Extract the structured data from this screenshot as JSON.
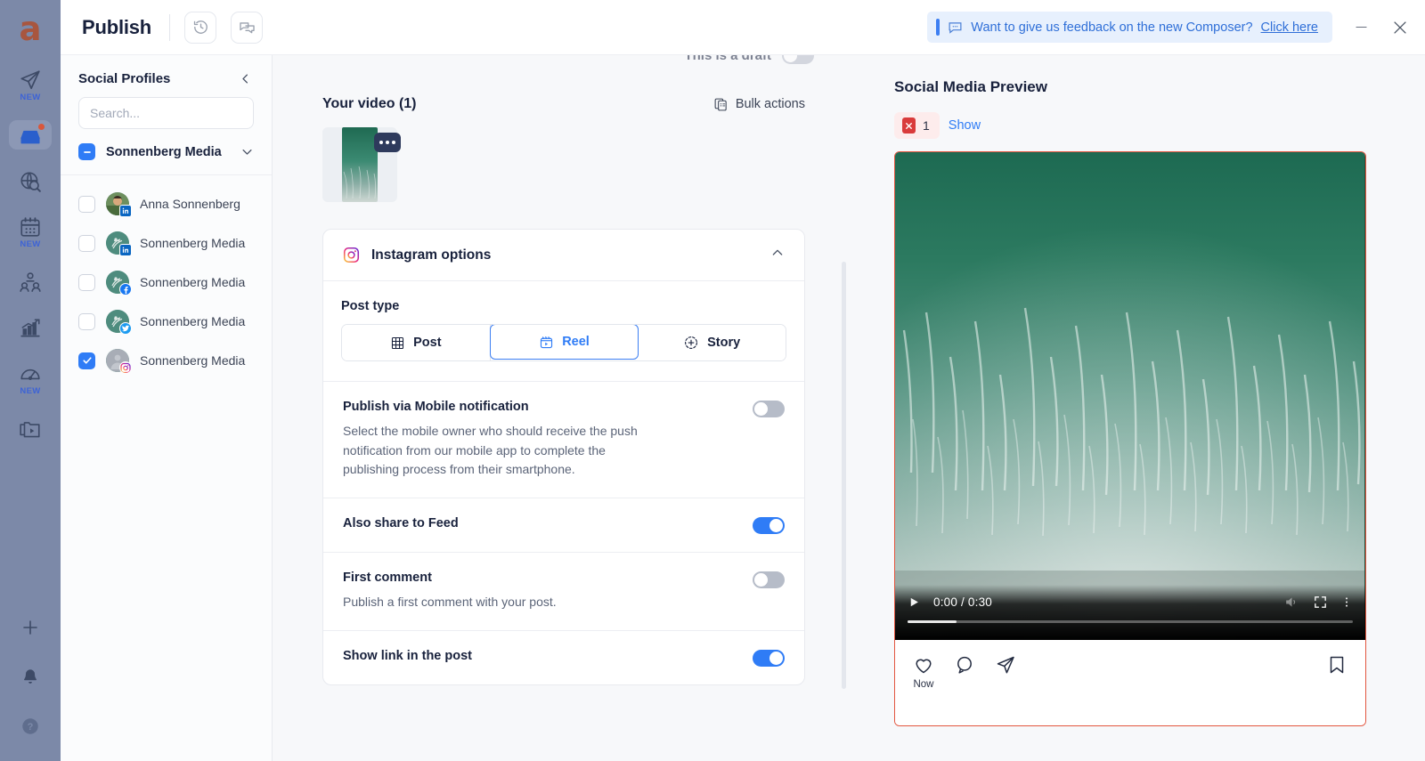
{
  "rail": {
    "logo": "a",
    "items": [
      {
        "name": "publish-send-icon",
        "badge": "NEW",
        "active": false
      },
      {
        "name": "engage-inbox-icon",
        "badge": "",
        "active": true,
        "dot": true
      },
      {
        "name": "listening-globe-icon",
        "badge": "",
        "active": false
      },
      {
        "name": "calendar-icon",
        "badge": "NEW",
        "active": false
      },
      {
        "name": "influencers-icon",
        "badge": "",
        "active": false
      },
      {
        "name": "analytics-icon",
        "badge": "",
        "active": false
      },
      {
        "name": "benchmark-gauge-icon",
        "badge": "NEW",
        "active": false
      },
      {
        "name": "media-library-icon",
        "badge": "",
        "active": false
      }
    ],
    "bottom_items": [
      {
        "name": "add-plus-icon"
      },
      {
        "name": "notifications-bell-icon"
      },
      {
        "name": "help-question-icon"
      }
    ]
  },
  "topbar": {
    "title": "Publish",
    "history_icon": "history-clock-icon",
    "comments_icon": "comments-icon",
    "feedback": {
      "icon": "chat-bubble-icon",
      "text": "Want to give us feedback on the new Composer?",
      "link": "Click here"
    },
    "minimize_label": "−",
    "close_label": "✕"
  },
  "sidebar": {
    "title": "Social Profiles",
    "collapse_icon": "chevron-left-icon",
    "search": {
      "placeholder": "Search...",
      "value": "",
      "icon": "search-icon"
    },
    "group": {
      "name": "Sonnenberg Media",
      "checkbox_state": "indeterminate",
      "expand_icon": "chevron-down-icon"
    },
    "profiles": [
      {
        "name": "Anna Sonnenberg",
        "network": "linkedin",
        "checked": false,
        "avatar_type": "photo"
      },
      {
        "name": "Sonnenberg Media",
        "network": "linkedin",
        "checked": false,
        "avatar_type": "logo"
      },
      {
        "name": "Sonnenberg Media",
        "network": "facebook",
        "checked": false,
        "avatar_type": "logo"
      },
      {
        "name": "Sonnenberg Media",
        "network": "twitter",
        "checked": false,
        "avatar_type": "logo"
      },
      {
        "name": "Sonnenberg Media",
        "network": "instagram",
        "checked": true,
        "avatar_type": "grey"
      }
    ]
  },
  "composer": {
    "draft_label": "This is a draft",
    "draft_toggle_on": false,
    "media_title": "Your video (1)",
    "bulk_actions_label": "Bulk actions",
    "bulk_actions_icon": "copy-stack-icon",
    "thumb_more_icon": "more-dots-icon",
    "options": {
      "network_icon": "instagram-icon",
      "header": "Instagram options",
      "collapse_icon": "chevron-up-icon",
      "post_type_label": "Post type",
      "post_types": [
        {
          "label": "Post",
          "icon": "grid-icon",
          "selected": false
        },
        {
          "label": "Reel",
          "icon": "reel-icon",
          "selected": true
        },
        {
          "label": "Story",
          "icon": "story-plus-icon",
          "selected": false
        }
      ],
      "rows": [
        {
          "title": "Publish via Mobile notification",
          "desc": "Select the mobile owner who should receive the push notification from our mobile app to complete the publishing process from their smartphone.",
          "toggle_on": false
        },
        {
          "title": "Also share to Feed",
          "desc": "",
          "toggle_on": true
        },
        {
          "title": "First comment",
          "desc": "Publish a first comment with your post.",
          "toggle_on": false
        },
        {
          "title": "Show link in the post",
          "desc": "",
          "toggle_on": true
        }
      ]
    }
  },
  "preview": {
    "title": "Social Media Preview",
    "error_icon": "error-badge-icon",
    "error_count": "1",
    "show_label": "Show",
    "video": {
      "play_icon": "play-icon",
      "time": "0:00 / 0:30",
      "volume_icon": "volume-muted-icon",
      "fullscreen_icon": "fullscreen-icon",
      "menu_icon": "kebab-menu-icon",
      "progress_percent": 11
    },
    "actions": [
      {
        "name": "like-heart-icon",
        "label": "Now"
      },
      {
        "name": "comment-icon",
        "label": ""
      },
      {
        "name": "share-paper-plane-icon",
        "label": ""
      }
    ],
    "save_icon": "bookmark-icon"
  }
}
